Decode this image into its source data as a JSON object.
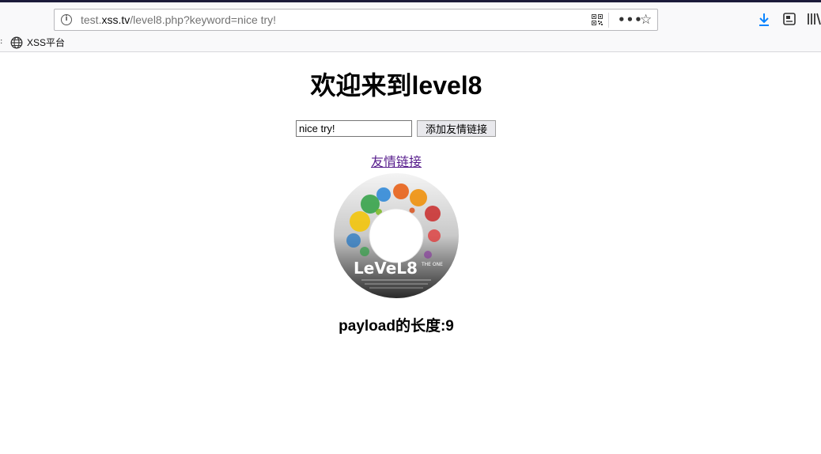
{
  "browser": {
    "url": {
      "prefix": "test.",
      "host": "xss.tv",
      "path": "/level8.php?keyword=nice try!"
    },
    "toolbar_icons": [
      "info-icon",
      "qr-code-icon",
      "more-icon",
      "star-icon",
      "download-icon",
      "pocket-icon",
      "library-icon"
    ],
    "accent_color": "#0a84ff"
  },
  "bookmarks": [
    {
      "label": "XSS平台",
      "icon": "globe-icon"
    }
  ],
  "page": {
    "title": "欢迎来到level8",
    "keyword_input_value": "nice try!",
    "add_button_label": "添加友情链接",
    "friend_link_text": "友情链接",
    "disc_logo_text": "LeVeL8",
    "disc_logo_suffix": "THE ONE",
    "payload_length": "payload的长度:9"
  }
}
